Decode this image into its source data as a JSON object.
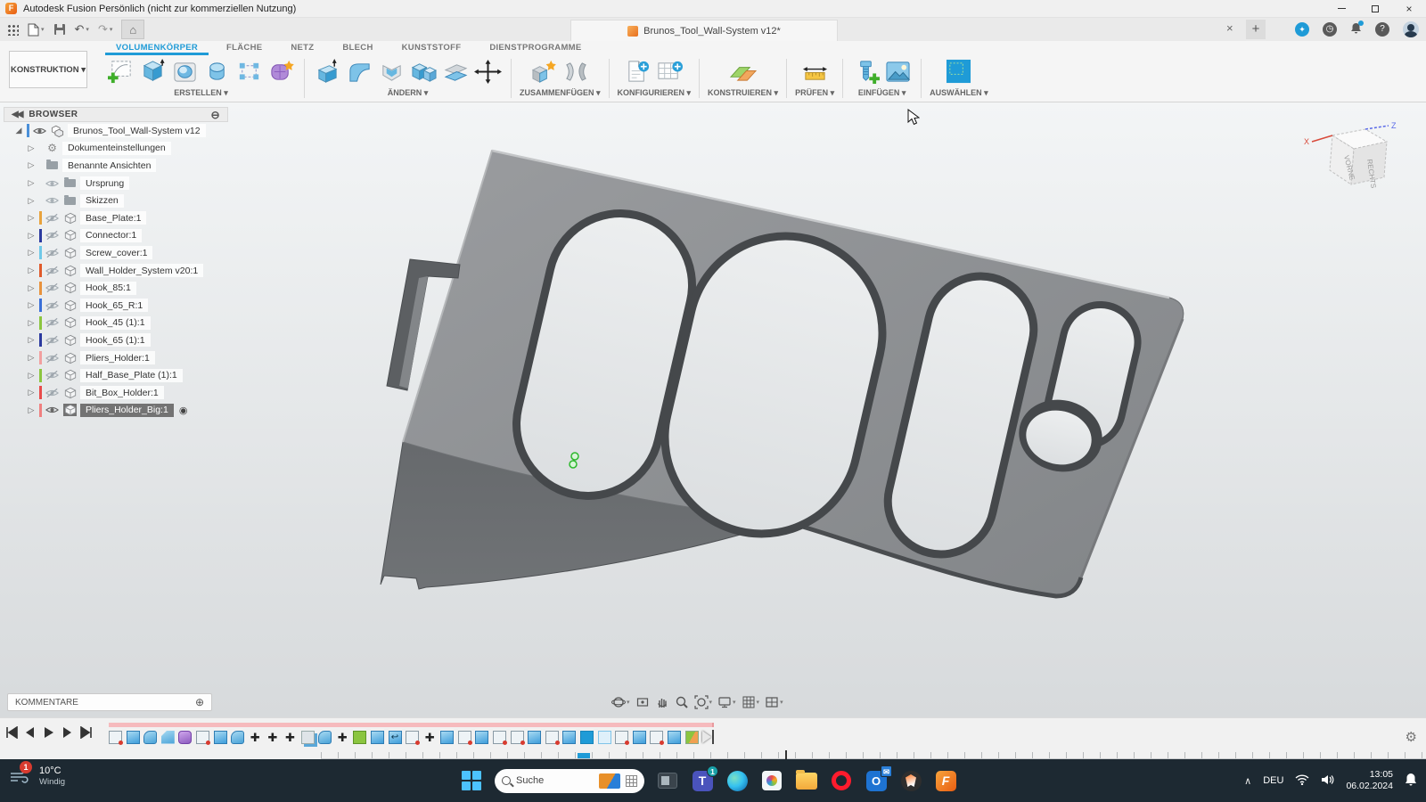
{
  "titlebar": {
    "app_title": "Autodesk Fusion Persönlich (nicht zur kommerziellen Nutzung)"
  },
  "appbar": {
    "doc_tab": "Brunos_Tool_Wall-System v12*"
  },
  "ribbon": {
    "workspace": "KONSTRUKTION ▾",
    "tabs": [
      {
        "label": "VOLUMENKÖRPER",
        "active": true
      },
      {
        "label": "FLÄCHE",
        "active": false
      },
      {
        "label": "NETZ",
        "active": false
      },
      {
        "label": "BLECH",
        "active": false
      },
      {
        "label": "KUNSTSTOFF",
        "active": false
      },
      {
        "label": "DIENSTPROGRAMME",
        "active": false
      }
    ],
    "groups": [
      {
        "label": "ERSTELLEN ▾",
        "icons": [
          "create-sketch",
          "extrude",
          "hole",
          "revolve",
          "pattern-box",
          "form"
        ]
      },
      {
        "label": "ÄNDERN ▾",
        "icons": [
          "press-pull",
          "fillet",
          "shell",
          "combine",
          "offset",
          "move"
        ]
      },
      {
        "label": "ZUSAMMENFÜGEN ▾",
        "icons": [
          "new-component",
          "joint"
        ]
      },
      {
        "label": "KONFIGURIEREN ▾",
        "icons": [
          "config-doc",
          "config-table"
        ]
      },
      {
        "label": "KONSTRUIEREN ▾",
        "icons": [
          "plane"
        ]
      },
      {
        "label": "PRÜFEN ▾",
        "icons": [
          "measure"
        ]
      },
      {
        "label": "EINFÜGEN ▾",
        "icons": [
          "insert-bolt",
          "canvas"
        ]
      },
      {
        "label": "AUSWÄHLEN ▾",
        "icons": [
          "select"
        ]
      }
    ]
  },
  "browser": {
    "header": "BROWSER",
    "items": [
      {
        "label": "Brunos_Tool_Wall-System v12",
        "icon": "assembly",
        "eye": "open",
        "bar": "#4a90d9",
        "root": true
      },
      {
        "label": "Dokumenteinstellungen",
        "icon": "gear",
        "eye": "none"
      },
      {
        "label": "Benannte Ansichten",
        "icon": "folder",
        "eye": "none"
      },
      {
        "label": "Ursprung",
        "icon": "folder",
        "eye": "dim"
      },
      {
        "label": "Skizzen",
        "icon": "folder",
        "eye": "dim"
      },
      {
        "label": "Base_Plate:1",
        "icon": "cube",
        "eye": "slash",
        "bar": "#e8a33d"
      },
      {
        "label": "Connector:1",
        "icon": "cube",
        "eye": "slash",
        "bar": "#2b3a9f"
      },
      {
        "label": "Screw_cover:1",
        "icon": "cube",
        "eye": "slash",
        "bar": "#6fc8e8"
      },
      {
        "label": "Wall_Holder_System v20:1",
        "icon": "cube",
        "eye": "slash",
        "bar": "#e05a2b"
      },
      {
        "label": "Hook_85:1",
        "icon": "cube",
        "eye": "slash",
        "bar": "#e8923d"
      },
      {
        "label": "Hook_65_R:1",
        "icon": "cube",
        "eye": "slash",
        "bar": "#3a6fd8"
      },
      {
        "label": "Hook_45 (1):1",
        "icon": "cube",
        "eye": "slash",
        "bar": "#8bc53f"
      },
      {
        "label": "Hook_65 (1):1",
        "icon": "cube",
        "eye": "slash",
        "bar": "#2b3a9f"
      },
      {
        "label": "Pliers_Holder:1",
        "icon": "cube",
        "eye": "slash",
        "bar": "#f2a0a0"
      },
      {
        "label": "Half_Base_Plate (1):1",
        "icon": "cube",
        "eye": "slash",
        "bar": "#8bc53f"
      },
      {
        "label": "Bit_Box_Holder:1",
        "icon": "cube",
        "eye": "slash",
        "bar": "#e84b4b"
      },
      {
        "label": "Pliers_Holder_Big:1",
        "icon": "cube",
        "eye": "open",
        "bar": "#f08080",
        "selected": true
      }
    ]
  },
  "viewcube": {
    "face_front": "VORNE",
    "face_right": "RECHTS",
    "axis_x": "X",
    "axis_z": "Z"
  },
  "comments": {
    "label": "KOMMENTARE"
  },
  "navbar": {
    "icons": [
      {
        "name": "orbit",
        "caret": true
      },
      {
        "name": "look-at",
        "caret": false
      },
      {
        "name": "pan",
        "caret": false
      },
      {
        "name": "zoom",
        "caret": false
      },
      {
        "name": "fit",
        "caret": true
      },
      {
        "name": "display",
        "caret": true
      },
      {
        "name": "grid",
        "caret": true
      },
      {
        "name": "viewports",
        "caret": true
      }
    ]
  },
  "timeline": {
    "items": [
      "sketch",
      "extrude",
      "fillet",
      "chamfer",
      "form",
      "sketch",
      "extrude",
      "fillet",
      "move",
      "move",
      "move",
      "copy",
      "fillet",
      "move",
      "pattern",
      "extrude",
      "paste",
      "sketch",
      "move",
      "extrude",
      "sketch",
      "extrude",
      "sketch",
      "sketch",
      "extrude",
      "sketch",
      "extrude",
      "selected",
      "ghost",
      "sketch",
      "extrude",
      "sketch",
      "extrude",
      "appearance",
      "marker"
    ]
  },
  "taskbar": {
    "weather": {
      "badge": "1",
      "temp": "10°C",
      "condition": "Windig"
    },
    "search_placeholder": "Suche",
    "apps": [
      "taskview",
      "teams",
      "edge",
      "photos",
      "explorer",
      "opera",
      "outlook",
      "brave",
      "fusion"
    ],
    "teams_badge": "1",
    "tray": {
      "lang": "DEU",
      "time": "13:05",
      "date": "06.02.2024"
    }
  }
}
